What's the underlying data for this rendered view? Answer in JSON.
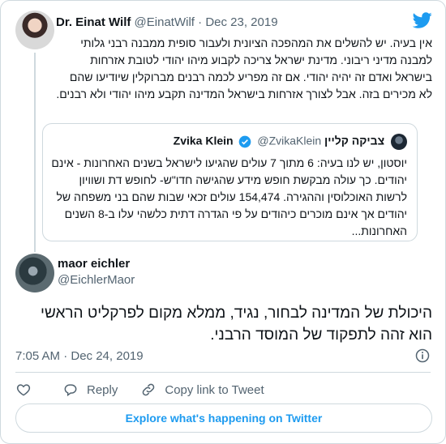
{
  "parent_tweet": {
    "name": "Dr. Einat Wilf",
    "handle": "@EinatWilf",
    "separator": "·",
    "date": "Dec 23, 2019",
    "text": "אין בעיה. יש להשלים את המהפכה הציונית ולעבור סופית ממבנה רבני גלותי למבנה מדיני ריבוני. מדינת ישראל צריכה לקבוע מיהו יהודי לטובת אזרחות בישראל ואדם זה יהיה יהודי. אם זה מפריע לכמה רבנים מברוקלין שיודיעו שהם לא מכירים בזה. אבל לצורך אזרחות בישראל המדינה תקבע מיהו יהודי ולא רבנים."
  },
  "quoted_tweet": {
    "name": "צביקה קליין Zvika Klein",
    "handle": "@ZvikaKlein",
    "text": "יוסטון, יש לנו בעיה: 6 מתוך 7 עולים שהגיעו לישראל בשנים האחרונות - אינם יהודים. כך עולה מבקשת חופש מידע שהגישה חדו\"ש- לחופש דת ושוויון לרשות האוכלוסין וההגירה. 154,474 עולים זכאי שבות שהם בני משפחה של יהודים אך אינם מוכרים כיהודים על פי הגדרה דתית כלשהי עלו ב-8 השנים האחרונות..."
  },
  "main_tweet": {
    "name": "maor eichler",
    "handle": "@EichlerMaor",
    "text": "היכולת של המדינה לבחור, נגיד, ממלא מקום לפרקליט הראשי הוא זהה לתפקוד של המוסד הרבני.",
    "time": "7:05 AM · Dec 24, 2019"
  },
  "actions": {
    "reply_label": "Reply",
    "copy_link_label": "Copy link to Tweet"
  },
  "explore_label": "Explore what's happening on Twitter",
  "colors": {
    "accent": "#1d9bf0",
    "verified": "#1d9bf0",
    "border": "#cfd9de",
    "secondary_text": "#536471"
  },
  "icons": [
    "twitter-bird-icon",
    "verified-badge-icon",
    "info-icon",
    "heart-icon",
    "reply-icon",
    "link-icon"
  ]
}
